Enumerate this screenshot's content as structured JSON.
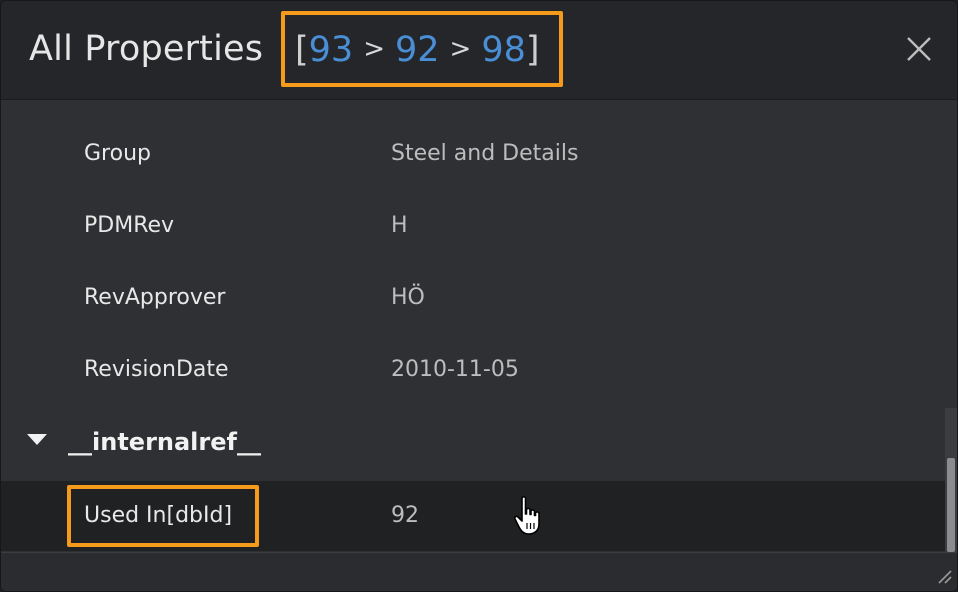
{
  "window": {
    "title": "All Properties",
    "breadcrumb": {
      "open": "[",
      "items": [
        "93",
        "92",
        "98"
      ],
      "separator": ">",
      "close": "]"
    }
  },
  "properties": [
    {
      "key": "Group",
      "value": "Steel and Details"
    },
    {
      "key": "PDMRev",
      "value": "H"
    },
    {
      "key": "RevApprover",
      "value": "HÖ"
    },
    {
      "key": "RevisionDate",
      "value": "2010-11-05"
    }
  ],
  "category": {
    "label": "__internalref__",
    "expanded": true
  },
  "selected_row": {
    "key": "Used In[dbId]",
    "value": "92"
  },
  "colors": {
    "highlight": "#f59a1b",
    "link": "#4a8fd6",
    "background": "#2e3033",
    "header": "#242629"
  },
  "icons": {
    "close": "close-icon",
    "expand": "triangle-down-icon",
    "cursor": "hand-pointer-icon",
    "resize": "resize-grip-icon"
  }
}
